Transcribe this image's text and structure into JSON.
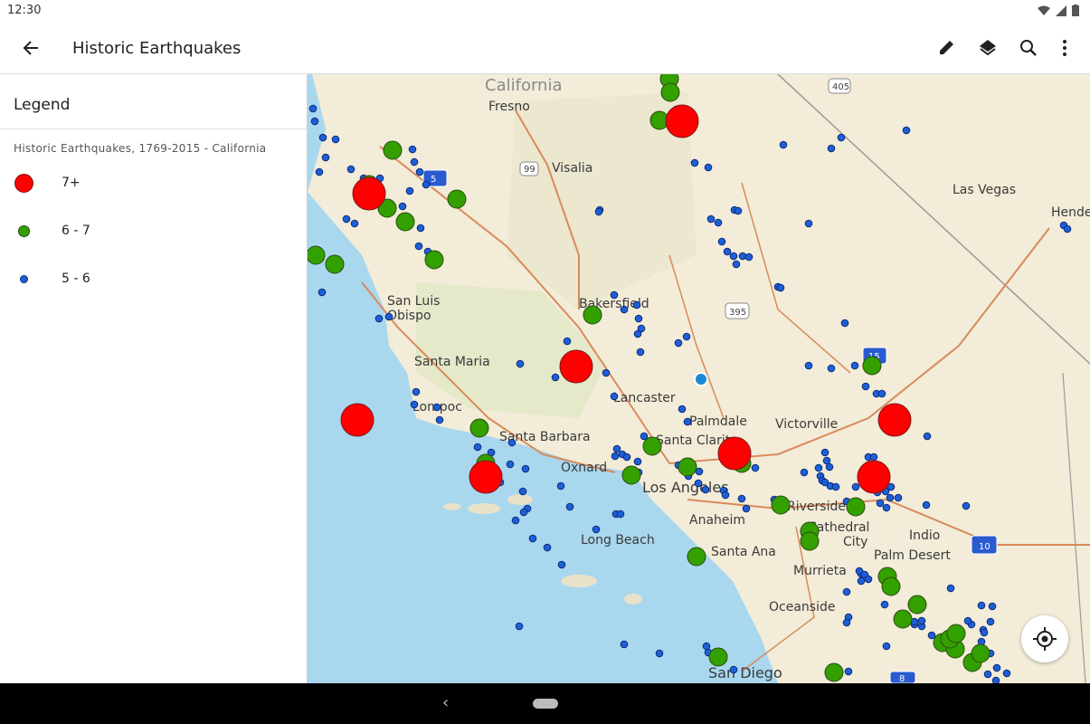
{
  "status_bar": {
    "time": "12:30",
    "icons": [
      "wifi-icon",
      "signal-icon",
      "battery-icon"
    ]
  },
  "app_bar": {
    "title": "Historic Earthquakes",
    "actions": [
      "edit-icon",
      "layers-icon",
      "search-icon",
      "more-vert-icon"
    ]
  },
  "legend": {
    "header": "Legend",
    "layer_name": "Historic Earthquakes, 1769-2015 - California",
    "items": [
      {
        "label": "7+",
        "color": "#ff0000"
      },
      {
        "label": "6 - 7",
        "color": "#33a000"
      },
      {
        "label": "5 - 6",
        "color": "#1f5fd6"
      }
    ]
  },
  "map": {
    "state_label": "California",
    "cities": [
      "Fresno",
      "Visalia",
      "Las Vegas",
      "Hende",
      "Bakersfield",
      "San Luis",
      "Obispo",
      "Santa Maria",
      "Lompoc",
      "Lancaster",
      "Palmdale",
      "Victorville",
      "Santa Barbara",
      "Santa Clarita",
      "Oxnard",
      "Los Angeles",
      "Riverside",
      "Anaheim",
      "Cathedral",
      "City",
      "Indio",
      "Long Beach",
      "Santa Ana",
      "Palm Desert",
      "Murrieta",
      "Oceanside",
      "San Diego"
    ],
    "highway_shields": [
      "405",
      "99",
      "395",
      "15",
      "10",
      "5",
      "8"
    ],
    "colors": {
      "land": "#f2ecd8",
      "ocean": "#a9d7ee",
      "road": "#d98a5a",
      "fault": "#9a9a9a"
    }
  },
  "nav_bar": {
    "back_icon": "‹"
  }
}
